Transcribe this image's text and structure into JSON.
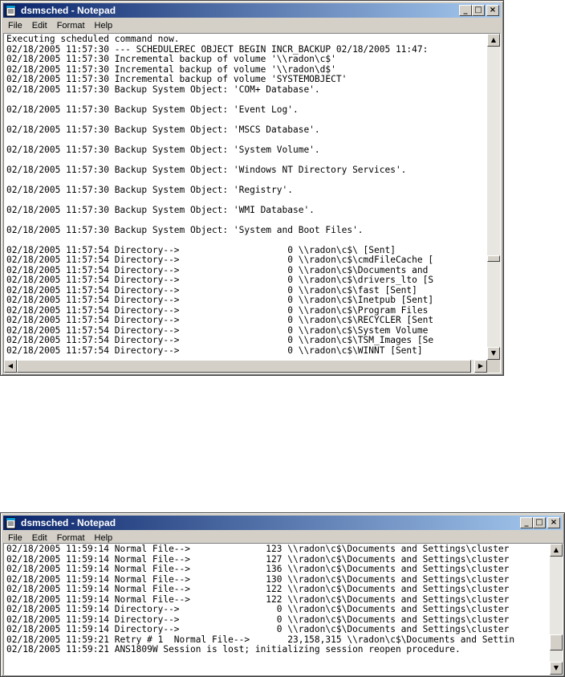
{
  "window1": {
    "title": "dsmsched - Notepad",
    "menu": [
      "File",
      "Edit",
      "Format",
      "Help"
    ],
    "lines": [
      {
        "text": "Executing scheduled command now.",
        "gap": false
      },
      {
        "text": "02/18/2005 11:57:30 --- SCHEDULEREC OBJECT BEGIN INCR_BACKUP 02/18/2005 11:47:",
        "gap": false
      },
      {
        "text": "02/18/2005 11:57:30 Incremental backup of volume '\\\\radon\\c$'",
        "gap": false
      },
      {
        "text": "02/18/2005 11:57:30 Incremental backup of volume '\\\\radon\\d$'",
        "gap": false
      },
      {
        "text": "02/18/2005 11:57:30 Incremental backup of volume 'SYSTEMOBJECT'",
        "gap": false
      },
      {
        "text": "02/18/2005 11:57:30 Backup System Object: 'COM+ Database'.",
        "gap": true
      },
      {
        "text": "02/18/2005 11:57:30 Backup System Object: 'Event Log'.",
        "gap": true
      },
      {
        "text": "02/18/2005 11:57:30 Backup System Object: 'MSCS Database'.",
        "gap": true
      },
      {
        "text": "02/18/2005 11:57:30 Backup System Object: 'System Volume'.",
        "gap": true
      },
      {
        "text": "02/18/2005 11:57:30 Backup System Object: 'Windows NT Directory Services'.",
        "gap": true
      },
      {
        "text": "02/18/2005 11:57:30 Backup System Object: 'Registry'.",
        "gap": true
      },
      {
        "text": "02/18/2005 11:57:30 Backup System Object: 'WMI Database'.",
        "gap": true
      },
      {
        "text": "02/18/2005 11:57:30 Backup System Object: 'System and Boot Files'.",
        "gap": true
      },
      {
        "text": "02/18/2005 11:57:54 Directory-->                    0 \\\\radon\\c$\\ [Sent]",
        "gap": false
      },
      {
        "text": "02/18/2005 11:57:54 Directory-->                    0 \\\\radon\\c$\\cmdFileCache [",
        "gap": false
      },
      {
        "text": "02/18/2005 11:57:54 Directory-->                    0 \\\\radon\\c$\\Documents and",
        "gap": false
      },
      {
        "text": "02/18/2005 11:57:54 Directory-->                    0 \\\\radon\\c$\\drivers_lto [S",
        "gap": false
      },
      {
        "text": "02/18/2005 11:57:54 Directory-->                    0 \\\\radon\\c$\\fast [Sent]",
        "gap": false
      },
      {
        "text": "02/18/2005 11:57:54 Directory-->                    0 \\\\radon\\c$\\Inetpub [Sent]",
        "gap": false
      },
      {
        "text": "02/18/2005 11:57:54 Directory-->                    0 \\\\radon\\c$\\Program Files",
        "gap": false
      },
      {
        "text": "02/18/2005 11:57:54 Directory-->                    0 \\\\radon\\c$\\RECYCLER [Sent",
        "gap": false
      },
      {
        "text": "02/18/2005 11:57:54 Directory-->                    0 \\\\radon\\c$\\System Volume",
        "gap": false
      },
      {
        "text": "02/18/2005 11:57:54 Directory-->                    0 \\\\radon\\c$\\TSM_Images [Se",
        "gap": false
      },
      {
        "text": "02/18/2005 11:57:54 Directory-->                    0 \\\\radon\\c$\\WINNT [Sent]",
        "gap": false
      }
    ]
  },
  "window2": {
    "title": "dsmsched - Notepad",
    "menu": [
      "File",
      "Edit",
      "Format",
      "Help"
    ],
    "lines": [
      {
        "text": "02/18/2005 11:59:14 Normal File-->              123 \\\\radon\\c$\\Documents and Settings\\cluster",
        "gap": false
      },
      {
        "text": "02/18/2005 11:59:14 Normal File-->              127 \\\\radon\\c$\\Documents and Settings\\cluster",
        "gap": false
      },
      {
        "text": "02/18/2005 11:59:14 Normal File-->              136 \\\\radon\\c$\\Documents and Settings\\cluster",
        "gap": false
      },
      {
        "text": "02/18/2005 11:59:14 Normal File-->              130 \\\\radon\\c$\\Documents and Settings\\cluster",
        "gap": false
      },
      {
        "text": "02/18/2005 11:59:14 Normal File-->              122 \\\\radon\\c$\\Documents and Settings\\cluster",
        "gap": false
      },
      {
        "text": "02/18/2005 11:59:14 Normal File-->              122 \\\\radon\\c$\\Documents and Settings\\cluster",
        "gap": false
      },
      {
        "text": "02/18/2005 11:59:14 Directory-->                  0 \\\\radon\\c$\\Documents and Settings\\cluster",
        "gap": false
      },
      {
        "text": "02/18/2005 11:59:14 Directory-->                  0 \\\\radon\\c$\\Documents and Settings\\cluster",
        "gap": false
      },
      {
        "text": "02/18/2005 11:59:14 Directory-->                  0 \\\\radon\\c$\\Documents and Settings\\cluster",
        "gap": false
      },
      {
        "text": "02/18/2005 11:59:21 Retry # 1  Normal File-->       23,158,315 \\\\radon\\c$\\Documents and Settin",
        "gap": false
      },
      {
        "text": "02/18/2005 11:59:21 ANS1809W Session is lost; initializing session reopen procedure.",
        "gap": false
      }
    ]
  },
  "icons": {
    "minimize": "_",
    "maximize": "□",
    "close": "×",
    "up": "▲",
    "down": "▼",
    "left": "◀",
    "right": "▶"
  }
}
